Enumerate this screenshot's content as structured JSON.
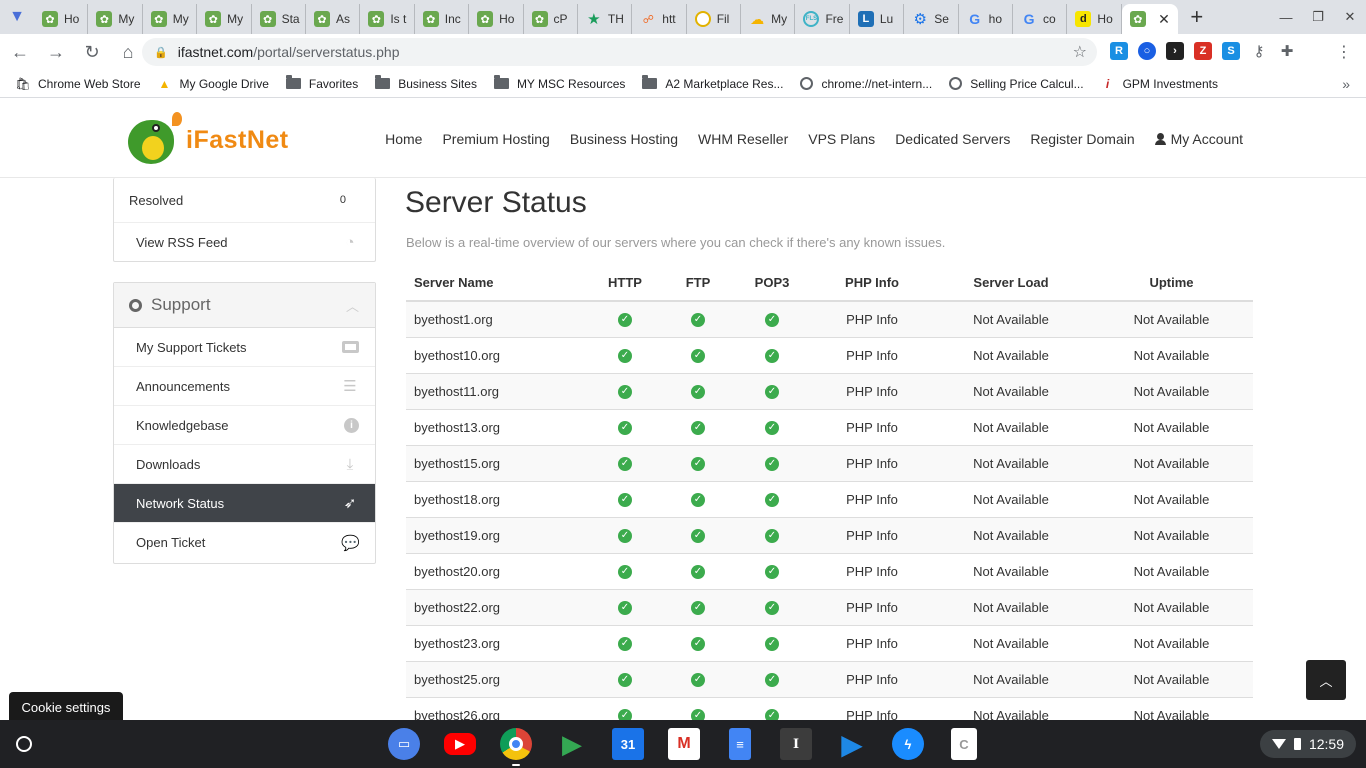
{
  "browser": {
    "tabs": [
      {
        "icon": "dragon-favicon",
        "label": "Ho"
      },
      {
        "icon": "dragon-favicon",
        "label": "My"
      },
      {
        "icon": "dragon-favicon",
        "label": "My"
      },
      {
        "icon": "dragon-favicon",
        "label": "My"
      },
      {
        "icon": "dragon-favicon",
        "label": "Sta"
      },
      {
        "icon": "dragon-favicon",
        "label": "As"
      },
      {
        "icon": "dragon-favicon",
        "label": "Is t"
      },
      {
        "icon": "dragon-favicon",
        "label": "Inc"
      },
      {
        "icon": "dragon-favicon",
        "label": "Ho"
      },
      {
        "icon": "dragon-favicon",
        "label": "cP"
      },
      {
        "icon": "star-favicon",
        "label": "TH"
      },
      {
        "icon": "link-favicon",
        "label": "htt"
      },
      {
        "icon": "clock-favicon",
        "label": "Fil"
      },
      {
        "icon": "cloud-favicon",
        "label": "My"
      },
      {
        "icon": "circle-favicon",
        "label": "Fre"
      },
      {
        "icon": "blue-favicon",
        "label": "Lu"
      },
      {
        "icon": "gear-favicon",
        "label": "Se"
      },
      {
        "icon": "google-favicon",
        "label": "ho"
      },
      {
        "icon": "google-favicon",
        "label": "co"
      },
      {
        "icon": "d-favicon",
        "label": "Ho"
      }
    ],
    "url_host": "ifastnet.com",
    "url_path": "/portal/serverstatus.php",
    "bookmarks": [
      {
        "icon": "webstore-icon",
        "label": "Chrome Web Store"
      },
      {
        "icon": "drive-icon",
        "label": "My Google Drive"
      },
      {
        "icon": "folder-icon",
        "label": "Favorites"
      },
      {
        "icon": "folder-icon",
        "label": "Business Sites"
      },
      {
        "icon": "folder-icon",
        "label": "MY MSC Resources"
      },
      {
        "icon": "folder-icon",
        "label": "A2 Marketplace Res..."
      },
      {
        "icon": "globe-icon",
        "label": "chrome://net-intern..."
      },
      {
        "icon": "globe-icon",
        "label": "Selling Price Calcul..."
      },
      {
        "icon": "info-i-icon",
        "label": "GPM Investments"
      }
    ]
  },
  "site": {
    "logo_text": "iFastNet",
    "nav": [
      "Home",
      "Premium Hosting",
      "Business Hosting",
      "WHM Reseller",
      "VPS Plans",
      "Dedicated Servers",
      "Register Domain",
      "My Account"
    ]
  },
  "sidebar": {
    "resolved_label": "Resolved",
    "resolved_count": "0",
    "rss_label": "View RSS Feed",
    "support_title": "Support",
    "support_items": [
      {
        "label": "My Support Tickets",
        "icon": "ticket-icon"
      },
      {
        "label": "Announcements",
        "icon": "list-icon"
      },
      {
        "label": "Knowledgebase",
        "icon": "info-icon"
      },
      {
        "label": "Downloads",
        "icon": "download-icon"
      },
      {
        "label": "Network Status",
        "icon": "rocket-icon"
      },
      {
        "label": "Open Ticket",
        "icon": "comments-icon"
      }
    ]
  },
  "main": {
    "title": "Server Status",
    "intro": "Below is a real-time overview of our servers where you can check if there's any known issues.",
    "columns": [
      "Server Name",
      "HTTP",
      "FTP",
      "POP3",
      "PHP Info",
      "Server Load",
      "Uptime"
    ],
    "rows": [
      {
        "name": "byethost1.org",
        "php": "PHP Info",
        "load": "Not Available",
        "uptime": "Not Available"
      },
      {
        "name": "byethost10.org",
        "php": "PHP Info",
        "load": "Not Available",
        "uptime": "Not Available"
      },
      {
        "name": "byethost11.org",
        "php": "PHP Info",
        "load": "Not Available",
        "uptime": "Not Available"
      },
      {
        "name": "byethost13.org",
        "php": "PHP Info",
        "load": "Not Available",
        "uptime": "Not Available"
      },
      {
        "name": "byethost15.org",
        "php": "PHP Info",
        "load": "Not Available",
        "uptime": "Not Available"
      },
      {
        "name": "byethost18.org",
        "php": "PHP Info",
        "load": "Not Available",
        "uptime": "Not Available"
      },
      {
        "name": "byethost19.org",
        "php": "PHP Info",
        "load": "Not Available",
        "uptime": "Not Available"
      },
      {
        "name": "byethost20.org",
        "php": "PHP Info",
        "load": "Not Available",
        "uptime": "Not Available"
      },
      {
        "name": "byethost22.org",
        "php": "PHP Info",
        "load": "Not Available",
        "uptime": "Not Available"
      },
      {
        "name": "byethost23.org",
        "php": "PHP Info",
        "load": "Not Available",
        "uptime": "Not Available"
      },
      {
        "name": "byethost25.org",
        "php": "PHP Info",
        "load": "Not Available",
        "uptime": "Not Available"
      },
      {
        "name": "byethost26.org",
        "php": "PHP Info",
        "load": "Not Available",
        "uptime": "Not Available"
      }
    ]
  },
  "cookie_label": "Cookie settings",
  "shelf": {
    "apps": [
      "files-icon",
      "youtube-icon",
      "chrome-icon",
      "play-store-icon",
      "calendar-icon",
      "gmail-icon",
      "docs-icon",
      "text-app-icon",
      "play-movies-icon",
      "messenger-icon",
      "clipboard-icon"
    ],
    "calendar_day": "31",
    "time": "12:59"
  }
}
